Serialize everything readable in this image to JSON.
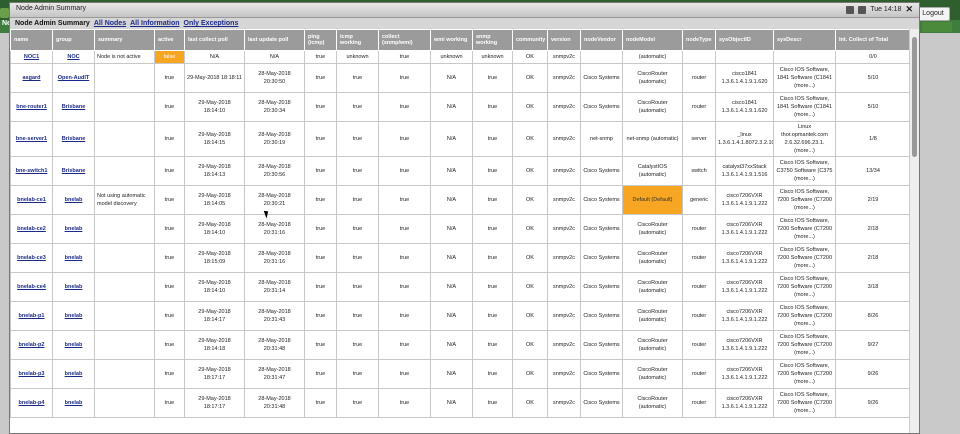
{
  "desktop": {
    "nav_text": "Neto",
    "clock": "Tue 14:18",
    "logout_label": "Logout"
  },
  "window": {
    "title": "Node Admin Summary"
  },
  "subbar": {
    "title": "Node Admin Summary",
    "links": [
      "All Nodes",
      "All Information",
      "Only Exceptions"
    ]
  },
  "table": {
    "columns": [
      "name",
      "group",
      "summary",
      "active",
      "last collect poll",
      "last update poll",
      "ping (icmp)",
      "icmp working",
      "collect (snmp/wmi)",
      "wmi working",
      "snmp working",
      "community",
      "version",
      "nodeVendor",
      "nodeModel",
      "nodeType",
      "sysObjectID",
      "sysDescr",
      "Int. Collect of Total"
    ],
    "rows": [
      {
        "name": "NOC1",
        "group": "NOC",
        "summary": "Node is not active",
        "active": "false",
        "last_collect": "N/A",
        "last_update": "N/A",
        "ping": "true",
        "icmp": "unknown",
        "collect": "true",
        "wmi": "unknown",
        "snmp": "unknown",
        "community": "OK",
        "version": "snmpv2c",
        "vendor": "",
        "model": "(automatic)",
        "type": "",
        "sysobj": "",
        "sysdescr": "",
        "intcollect": "0/0"
      },
      {
        "name": "asgard",
        "group": "Open-AudIT",
        "summary": "",
        "active": "true",
        "last_collect": "29-May-2018 18:18:11",
        "last_update": "28-May-2018 20:30:50",
        "ping": "true",
        "icmp": "true",
        "collect": "true",
        "wmi": "N/A",
        "snmp": "true",
        "community": "OK",
        "version": "snmpv2c",
        "vendor": "Cisco Systems",
        "model": "CiscoRouter (automatic)",
        "type": "router",
        "sysobj": "cisco1841 1.3.6.1.4.1.9.1.620",
        "sysdescr": "Cisco IOS Software, 1841 Software (C1841 (more...)",
        "intcollect": "5/10"
      },
      {
        "name": "bne-router1",
        "group": "Brisbane",
        "summary": "",
        "active": "true",
        "last_collect": "29-May-2018 18:14:10",
        "last_update": "28-May-2018 20:30:34",
        "ping": "true",
        "icmp": "true",
        "collect": "true",
        "wmi": "N/A",
        "snmp": "true",
        "community": "OK",
        "version": "snmpv2c",
        "vendor": "Cisco Systems",
        "model": "CiscoRouter (automatic)",
        "type": "router",
        "sysobj": "cisco1841 1.3.6.1.4.1.9.1.620",
        "sysdescr": "Cisco IOS Software, 1841 Software (C1841 (more...)",
        "intcollect": "5/10"
      },
      {
        "name": "bne-server1",
        "group": "Brisbane",
        "summary": "",
        "active": "true",
        "last_collect": "29-May-2018 18:14:15",
        "last_update": "28-May-2018 20:30:19",
        "ping": "true",
        "icmp": "true",
        "collect": "true",
        "wmi": "N/A",
        "snmp": "true",
        "community": "OK",
        "version": "snmpv2c",
        "vendor": "net-snmp",
        "model": "net-snmp (automatic)",
        "type": "server",
        "sysobj": "_linux 1.3.6.1.4.1.8072.3.2.10",
        "sysdescr": "Linux thor.opmantek.com 2.6.32.696.23.1. (more...)",
        "intcollect": "1/8"
      },
      {
        "name": "bne-switch1",
        "group": "Brisbane",
        "summary": "",
        "active": "true",
        "last_collect": "29-May-2018 18:14:13",
        "last_update": "28-May-2018 20:30:56",
        "ping": "true",
        "icmp": "true",
        "collect": "true",
        "wmi": "N/A",
        "snmp": "true",
        "community": "OK",
        "version": "snmpv2c",
        "vendor": "Cisco Systems",
        "model": "CatalystIOS (automatic)",
        "type": "switch",
        "sysobj": "catalyst37xxStack 1.3.6.1.4.1.9.1.516",
        "sysdescr": "Cisco IOS Software, C3750 Software (C375 (more...)",
        "intcollect": "13/34"
      },
      {
        "name": "bnelab-ce1",
        "group": "bnelab",
        "summary": "Not using automatic model discovery",
        "active": "true",
        "last_collect": "29-May-2018 18:14:05",
        "last_update": "28-May-2018 20:30:21",
        "ping": "true",
        "icmp": "true",
        "collect": "true",
        "wmi": "N/A",
        "snmp": "true",
        "community": "OK",
        "version": "snmpv2c",
        "vendor": "Cisco Systems",
        "model": "Default (Default)",
        "type": "generic",
        "sysobj": "cisco7206VXR 1.3.6.1.4.1.9.1.222",
        "sysdescr": "Cisco IOS Software, 7200 Software (C7200 (more...)",
        "intcollect": "2/19"
      },
      {
        "name": "bnelab-ce2",
        "group": "bnelab",
        "summary": "",
        "active": "true",
        "last_collect": "29-May-2018 18:14:10",
        "last_update": "28-May-2018 20:31:16",
        "ping": "true",
        "icmp": "true",
        "collect": "true",
        "wmi": "N/A",
        "snmp": "true",
        "community": "OK",
        "version": "snmpv2c",
        "vendor": "Cisco Systems",
        "model": "CiscoRouter (automatic)",
        "type": "router",
        "sysobj": "cisco7206VXR 1.3.6.1.4.1.9.1.222",
        "sysdescr": "Cisco IOS Software, 7200 Software (C7200 (more...)",
        "intcollect": "2/18"
      },
      {
        "name": "bnelab-ce3",
        "group": "bnelab",
        "summary": "",
        "active": "true",
        "last_collect": "29-May-2018 18:15:09",
        "last_update": "28-May-2018 20:31:16",
        "ping": "true",
        "icmp": "true",
        "collect": "true",
        "wmi": "N/A",
        "snmp": "true",
        "community": "OK",
        "version": "snmpv2c",
        "vendor": "Cisco Systems",
        "model": "CiscoRouter (automatic)",
        "type": "router",
        "sysobj": "cisco7206VXR 1.3.6.1.4.1.9.1.222",
        "sysdescr": "Cisco IOS Software, 7200 Software (C7200 (more...)",
        "intcollect": "2/18"
      },
      {
        "name": "bnelab-ce4",
        "group": "bnelab",
        "summary": "",
        "active": "true",
        "last_collect": "29-May-2018 18:14:10",
        "last_update": "28-May-2018 20:31:14",
        "ping": "true",
        "icmp": "true",
        "collect": "true",
        "wmi": "N/A",
        "snmp": "true",
        "community": "OK",
        "version": "snmpv2c",
        "vendor": "Cisco Systems",
        "model": "CiscoRouter (automatic)",
        "type": "router",
        "sysobj": "cisco7206VXR 1.3.6.1.4.1.9.1.222",
        "sysdescr": "Cisco IOS Software, 7200 Software (C7200 (more...)",
        "intcollect": "3/18"
      },
      {
        "name": "bnelab-p1",
        "group": "bnelab",
        "summary": "",
        "active": "true",
        "last_collect": "29-May-2018 18:14:17",
        "last_update": "28-May-2018 20:31:43",
        "ping": "true",
        "icmp": "true",
        "collect": "true",
        "wmi": "N/A",
        "snmp": "true",
        "community": "OK",
        "version": "snmpv2c",
        "vendor": "Cisco Systems",
        "model": "CiscoRouter (automatic)",
        "type": "router",
        "sysobj": "cisco7206VXR 1.3.6.1.4.1.9.1.222",
        "sysdescr": "Cisco IOS Software, 7200 Software (C7200 (more...)",
        "intcollect": "8/26"
      },
      {
        "name": "bnelab-p2",
        "group": "bnelab",
        "summary": "",
        "active": "true",
        "last_collect": "29-May-2018 18:14:18",
        "last_update": "28-May-2018 20:31:48",
        "ping": "true",
        "icmp": "true",
        "collect": "true",
        "wmi": "N/A",
        "snmp": "true",
        "community": "OK",
        "version": "snmpv2c",
        "vendor": "Cisco Systems",
        "model": "CiscoRouter (automatic)",
        "type": "router",
        "sysobj": "cisco7206VXR 1.3.6.1.4.1.9.1.222",
        "sysdescr": "Cisco IOS Software, 7200 Software (C7200 (more...)",
        "intcollect": "9/27"
      },
      {
        "name": "bnelab-p3",
        "group": "bnelab",
        "summary": "",
        "active": "true",
        "last_collect": "29-May-2018 18:17:17",
        "last_update": "28-May-2018 20:31:47",
        "ping": "true",
        "icmp": "true",
        "collect": "true",
        "wmi": "N/A",
        "snmp": "true",
        "community": "OK",
        "version": "snmpv2c",
        "vendor": "Cisco Systems",
        "model": "CiscoRouter (automatic)",
        "type": "router",
        "sysobj": "cisco7206VXR 1.3.6.1.4.1.9.1.222",
        "sysdescr": "Cisco IOS Software, 7200 Software (C7200 (more...)",
        "intcollect": "9/26"
      },
      {
        "name": "bnelab-p4",
        "group": "bnelab",
        "summary": "",
        "active": "true",
        "last_collect": "29-May-2018 18:17:17",
        "last_update": "28-May-2018 20:31:48",
        "ping": "true",
        "icmp": "true",
        "collect": "true",
        "wmi": "N/A",
        "snmp": "true",
        "community": "OK",
        "version": "snmpv2c",
        "vendor": "Cisco Systems",
        "model": "CiscoRouter (automatic)",
        "type": "router",
        "sysobj": "cisco7206VXR 1.3.6.1.4.1.9.1.222",
        "sysdescr": "Cisco IOS Software, 7200 Software (C7200 (more...)",
        "intcollect": "9/26"
      }
    ]
  },
  "colors": {
    "header_bg": "#9b9b9b",
    "highlight": "#f6a623",
    "link": "#1a2a8a",
    "desktop_green": "#3f7d3f"
  }
}
